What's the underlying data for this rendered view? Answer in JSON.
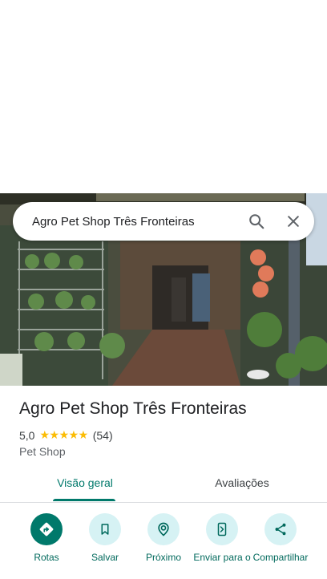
{
  "search": {
    "query": "Agro Pet Shop Três Fronteiras"
  },
  "icons": {
    "search": "search-icon",
    "close": "close-icon",
    "directions": "directions-icon",
    "save": "bookmark-icon",
    "nearby": "nearby-icon",
    "send": "send-to-phone-icon",
    "share": "share-icon"
  },
  "place": {
    "name": "Agro Pet Shop Três Fronteiras",
    "rating": "5,0",
    "stars": "★★★★★",
    "review_count": "(54)",
    "category": "Pet Shop"
  },
  "tabs": [
    {
      "label": "Visão geral",
      "selected": true
    },
    {
      "label": "Avaliações",
      "selected": false
    }
  ],
  "actions": [
    {
      "label": "Rotas"
    },
    {
      "label": "Salvar"
    },
    {
      "label": "Próximo"
    },
    {
      "label": "Enviar para o"
    },
    {
      "label": "Compartilhar"
    }
  ],
  "colors": {
    "accent": "#00796b",
    "chip_bg": "#d6f2f4",
    "star": "#fbbc04"
  }
}
